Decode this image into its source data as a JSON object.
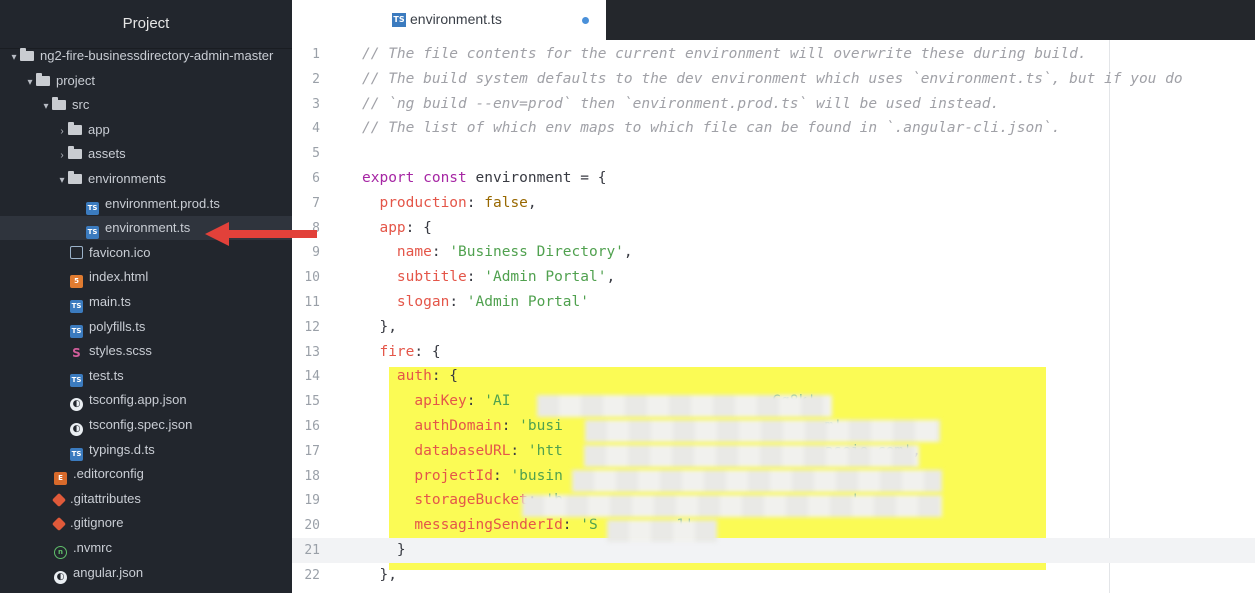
{
  "sidebar": {
    "title": "Project",
    "items": [
      {
        "label": "ng2-fire-businessdirectory-admin-master",
        "type": "folder",
        "expanded": true,
        "depth": 0
      },
      {
        "label": "project",
        "type": "folder",
        "expanded": true,
        "depth": 1
      },
      {
        "label": "src",
        "type": "folder",
        "expanded": true,
        "depth": 2
      },
      {
        "label": "app",
        "type": "folder",
        "expanded": false,
        "depth": 3
      },
      {
        "label": "assets",
        "type": "folder",
        "expanded": false,
        "depth": 3
      },
      {
        "label": "environments",
        "type": "folder",
        "expanded": true,
        "depth": 3
      },
      {
        "label": "environment.prod.ts",
        "type": "ts",
        "depth": 4
      },
      {
        "label": "environment.ts",
        "type": "ts",
        "depth": 4,
        "selected": true
      },
      {
        "label": "favicon.ico",
        "type": "img",
        "depth": 3
      },
      {
        "label": "index.html",
        "type": "html",
        "depth": 3
      },
      {
        "label": "main.ts",
        "type": "ts",
        "depth": 3
      },
      {
        "label": "polyfills.ts",
        "type": "ts",
        "depth": 3
      },
      {
        "label": "styles.scss",
        "type": "scss",
        "depth": 3
      },
      {
        "label": "test.ts",
        "type": "ts",
        "depth": 3
      },
      {
        "label": "tsconfig.app.json",
        "type": "json",
        "depth": 3
      },
      {
        "label": "tsconfig.spec.json",
        "type": "json",
        "depth": 3
      },
      {
        "label": "typings.d.ts",
        "type": "ts",
        "depth": 3
      },
      {
        "label": ".editorconfig",
        "type": "edcfg",
        "depth": 2
      },
      {
        "label": ".gitattributes",
        "type": "git",
        "depth": 2
      },
      {
        "label": ".gitignore",
        "type": "git",
        "depth": 2
      },
      {
        "label": ".nvmrc",
        "type": "nvm",
        "depth": 2
      },
      {
        "label": "angular.json",
        "type": "json",
        "depth": 2
      }
    ]
  },
  "editor": {
    "tab_label": "environment.ts",
    "tab_icon": "TS",
    "lines": [
      {
        "n": "1",
        "segs": [
          [
            "cm",
            "// The file contents for the current environment will overwrite these during build."
          ]
        ]
      },
      {
        "n": "2",
        "segs": [
          [
            "cm",
            "// The build system defaults to the dev environment which uses `environment.ts`, but if you do"
          ]
        ]
      },
      {
        "n": "3",
        "segs": [
          [
            "cm",
            "// `ng build --env=prod` then `environment.prod.ts` will be used instead."
          ]
        ]
      },
      {
        "n": "4",
        "segs": [
          [
            "cm",
            "// The list of which env maps to which file can be found in `.angular-cli.json`."
          ]
        ]
      },
      {
        "n": "5",
        "segs": []
      },
      {
        "n": "6",
        "segs": [
          [
            "kw",
            "export const "
          ],
          [
            "pu",
            "environment = {"
          ]
        ]
      },
      {
        "n": "7",
        "segs": [
          [
            "pu",
            "  "
          ],
          [
            "pr",
            "production"
          ],
          [
            "pu",
            ": "
          ],
          [
            "bo",
            "false"
          ],
          [
            "pu",
            ","
          ]
        ]
      },
      {
        "n": "8",
        "segs": [
          [
            "pu",
            "  "
          ],
          [
            "pr",
            "app"
          ],
          [
            "pu",
            ": {"
          ]
        ]
      },
      {
        "n": "9",
        "segs": [
          [
            "pu",
            "    "
          ],
          [
            "pr",
            "name"
          ],
          [
            "pu",
            ": "
          ],
          [
            "st",
            "'Business Directory'"
          ],
          [
            "pu",
            ","
          ]
        ]
      },
      {
        "n": "10",
        "segs": [
          [
            "pu",
            "    "
          ],
          [
            "pr",
            "subtitle"
          ],
          [
            "pu",
            ": "
          ],
          [
            "st",
            "'Admin Portal'"
          ],
          [
            "pu",
            ","
          ]
        ]
      },
      {
        "n": "11",
        "segs": [
          [
            "pu",
            "    "
          ],
          [
            "pr",
            "slogan"
          ],
          [
            "pu",
            ": "
          ],
          [
            "st",
            "'Admin Portal'"
          ]
        ]
      },
      {
        "n": "12",
        "segs": [
          [
            "pu",
            "  },"
          ]
        ]
      },
      {
        "n": "13",
        "segs": [
          [
            "pu",
            "  "
          ],
          [
            "pr",
            "fire"
          ],
          [
            "pu",
            ": {"
          ]
        ]
      },
      {
        "n": "14",
        "segs": [
          [
            "pu",
            "    "
          ],
          [
            "pr",
            "auth"
          ],
          [
            "pu",
            ": {"
          ]
        ]
      },
      {
        "n": "15",
        "segs": [
          [
            "pu",
            "      "
          ],
          [
            "pr",
            "apiKey"
          ],
          [
            "pu",
            ": "
          ],
          [
            "st",
            "'AI                              Gq8k'"
          ],
          [
            "pu",
            ","
          ]
        ]
      },
      {
        "n": "16",
        "segs": [
          [
            "pu",
            "      "
          ],
          [
            "pr",
            "authDomain"
          ],
          [
            "pu",
            ": "
          ],
          [
            "st",
            "'busi                              m'"
          ],
          [
            "pu",
            ","
          ]
        ]
      },
      {
        "n": "17",
        "segs": [
          [
            "pu",
            "      "
          ],
          [
            "pr",
            "databaseURL"
          ],
          [
            "pu",
            ": "
          ],
          [
            "st",
            "'htt                              aseio.com'"
          ],
          [
            "pu",
            ","
          ]
        ]
      },
      {
        "n": "18",
        "segs": [
          [
            "pu",
            "      "
          ],
          [
            "pr",
            "projectId"
          ],
          [
            "pu",
            ": "
          ],
          [
            "st",
            "'busin"
          ]
        ]
      },
      {
        "n": "19",
        "segs": [
          [
            "pu",
            "      "
          ],
          [
            "pr",
            "storageBucket"
          ],
          [
            "pu",
            ": "
          ],
          [
            "st",
            "'b                                 '"
          ],
          [
            "pu",
            ","
          ]
        ]
      },
      {
        "n": "20",
        "segs": [
          [
            "pu",
            "      "
          ],
          [
            "pr",
            "messagingSenderId"
          ],
          [
            "pu",
            ": "
          ],
          [
            "st",
            "'S         1'"
          ]
        ]
      },
      {
        "n": "21",
        "segs": [
          [
            "pu",
            "    }"
          ]
        ],
        "cursor": true
      },
      {
        "n": "22",
        "segs": [
          [
            "pu",
            "  },"
          ]
        ]
      }
    ]
  }
}
